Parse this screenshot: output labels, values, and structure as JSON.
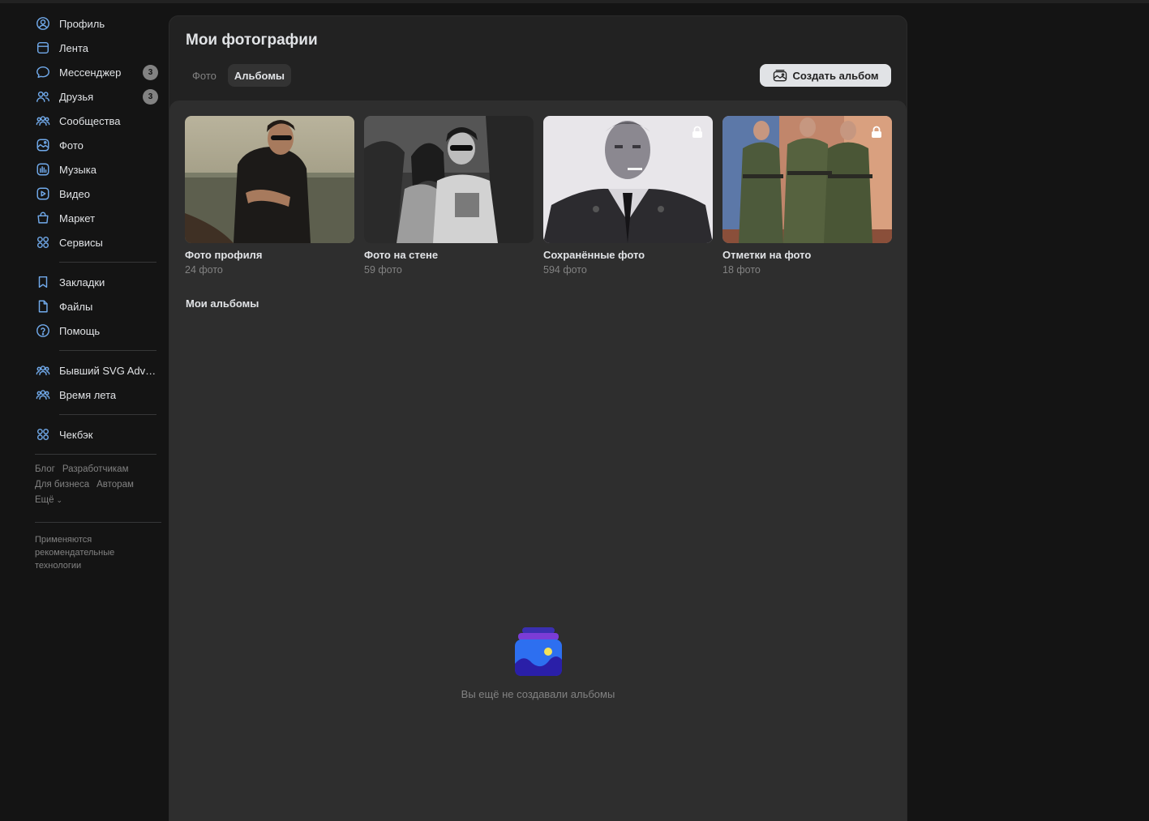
{
  "sidebar": {
    "items": [
      {
        "label": "Профиль",
        "icon": "profile-icon"
      },
      {
        "label": "Лента",
        "icon": "news-icon"
      },
      {
        "label": "Мессенджер",
        "icon": "message-icon",
        "badge": "3"
      },
      {
        "label": "Друзья",
        "icon": "friends-icon",
        "badge": "3"
      },
      {
        "label": "Сообщества",
        "icon": "communities-icon"
      },
      {
        "label": "Фото",
        "icon": "photo-icon"
      },
      {
        "label": "Музыка",
        "icon": "music-icon"
      },
      {
        "label": "Видео",
        "icon": "video-icon"
      },
      {
        "label": "Маркет",
        "icon": "market-icon"
      },
      {
        "label": "Сервисы",
        "icon": "services-icon"
      }
    ],
    "items2": [
      {
        "label": "Закладки",
        "icon": "bookmark-icon"
      },
      {
        "label": "Файлы",
        "icon": "file-icon"
      },
      {
        "label": "Помощь",
        "icon": "help-icon"
      }
    ],
    "groups": [
      {
        "label": "Бывший SVG Adventures",
        "icon": "group-icon"
      },
      {
        "label": "Время лета",
        "icon": "group-icon"
      }
    ],
    "apps": [
      {
        "label": "Чекбэк",
        "icon": "apps-icon"
      }
    ],
    "footer_links": {
      "blog": "Блог",
      "developers": "Разработчикам",
      "business": "Для бизнеса",
      "authors": "Авторам",
      "more": "Ещё"
    },
    "footer_note": "Применяются рекомендательные технологии"
  },
  "main": {
    "title": "Мои фотографии",
    "tabs": [
      {
        "label": "Фото",
        "active": false
      },
      {
        "label": "Альбомы",
        "active": true
      }
    ],
    "create_button": "Создать альбом",
    "albums": [
      {
        "name": "Фото профиля",
        "count": "24 фото",
        "locked": false
      },
      {
        "name": "Фото на стене",
        "count": "59 фото",
        "locked": false
      },
      {
        "name": "Сохранённые фото",
        "count": "594 фото",
        "locked": true
      },
      {
        "name": "Отметки на фото",
        "count": "18 фото",
        "locked": true
      }
    ],
    "my_albums_title": "Мои альбомы",
    "empty_text": "Вы ещё не создавали альбомы"
  },
  "colors": {
    "accent": "#71aaeb",
    "background": "#141414",
    "panel": "#222222",
    "text_secondary": "#828282"
  }
}
